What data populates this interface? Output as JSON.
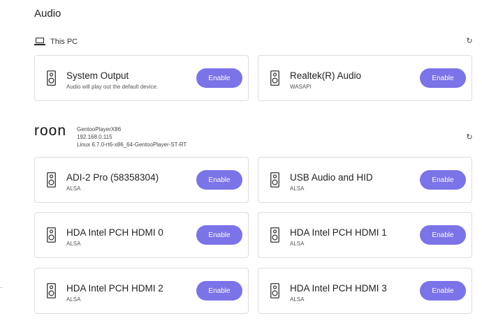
{
  "page": {
    "title": "Audio"
  },
  "this_pc": {
    "label": "This PC",
    "icon": "laptop-icon",
    "devices": [
      {
        "name": "System Output",
        "subtitle": "Audio will play out the default device.",
        "button": "Enable"
      },
      {
        "name": "Realtek(R) Audio",
        "subtitle": "WASAPI",
        "button": "Enable"
      }
    ]
  },
  "roon": {
    "logo": "roon",
    "host": "GentooPlayerX86",
    "ip": "192.168.0.115",
    "os": "Linux 6.7.0-rt6-x86_64-GentooPlayer-ST-RT",
    "devices": [
      {
        "name": "ADI-2 Pro (58358304)",
        "subtitle": "ALSA",
        "button": "Enable"
      },
      {
        "name": "USB Audio and HID",
        "subtitle": "ALSA",
        "button": "Enable"
      },
      {
        "name": "HDA Intel PCH HDMI 0",
        "subtitle": "ALSA",
        "button": "Enable"
      },
      {
        "name": "HDA Intel PCH HDMI 1",
        "subtitle": "ALSA",
        "button": "Enable"
      },
      {
        "name": "HDA Intel PCH HDMI 2",
        "subtitle": "ALSA",
        "button": "Enable"
      },
      {
        "name": "HDA Intel PCH HDMI 3",
        "subtitle": "ALSA",
        "button": "Enable"
      }
    ]
  },
  "colors": {
    "accent": "#7b73e8",
    "border": "#dcdcdc"
  }
}
